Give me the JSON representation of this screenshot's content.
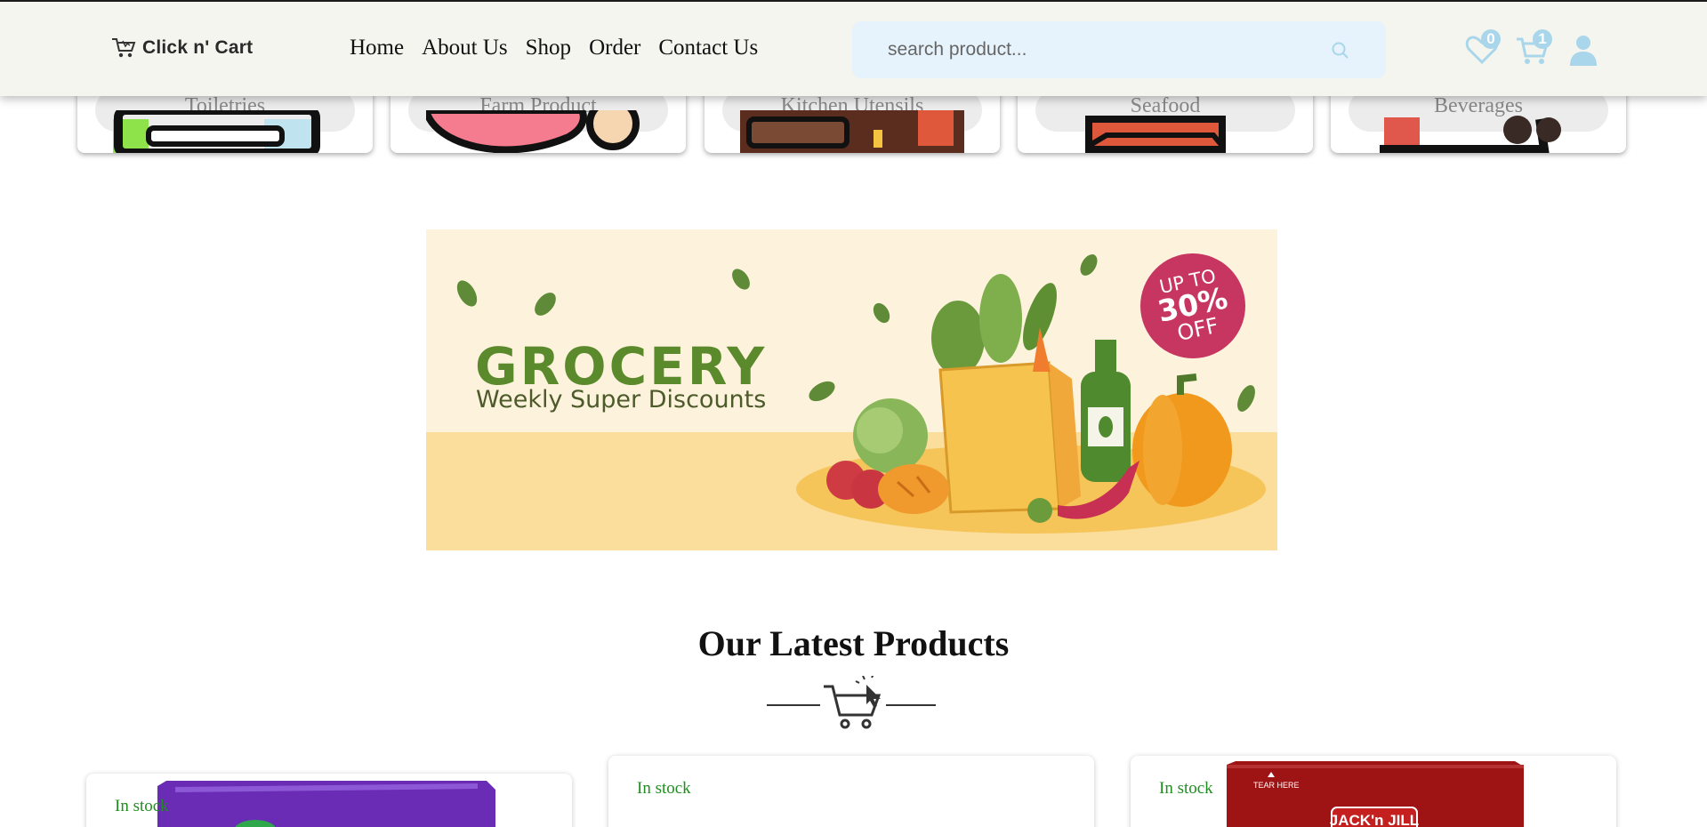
{
  "header": {
    "logo_text": "Click n' Cart",
    "nav": [
      "Home",
      "About Us",
      "Shop",
      "Order",
      "Contact Us"
    ],
    "search_placeholder": "search product...",
    "wishlist_count": "0",
    "cart_count": "1"
  },
  "categories": [
    {
      "label": "Toiletries"
    },
    {
      "label": "Farm Product"
    },
    {
      "label": "Kitchen Utensils"
    },
    {
      "label": "Seafood"
    },
    {
      "label": "Beverages"
    }
  ],
  "banner": {
    "title": "GROCERY",
    "subtitle": "Weekly Super Discounts",
    "offer_line1": "UP TO",
    "offer_line2": "30%",
    "offer_line3": "OFF"
  },
  "latest": {
    "title": "Our Latest Products",
    "products": [
      {
        "stock": "In stock"
      },
      {
        "stock": "In stock"
      },
      {
        "stock": "In stock",
        "brand_text": "JACK'n JILL",
        "tear_text": "TEAR HERE"
      }
    ]
  },
  "colors": {
    "header_bg": "#f4f5ee",
    "search_bg": "#e6f3fc",
    "icon_blue": "#a9d6ea",
    "banner_top": "#fdf3dd",
    "banner_bottom": "#fbdd9c",
    "offer": "#c73561",
    "stock_green": "#1e8f1e"
  }
}
